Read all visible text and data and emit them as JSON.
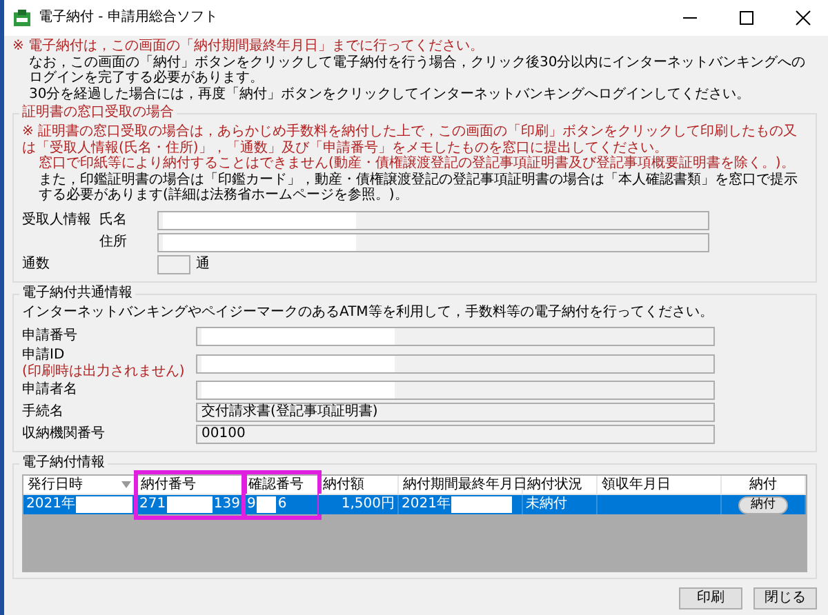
{
  "window": {
    "title": "電子納付 - 申請用総合ソフト"
  },
  "notices": [
    {
      "kind": "warning",
      "text": "※ 電子納付は，この画面の「納付期間最終年月日」までに行ってください。"
    },
    {
      "kind": "info",
      "text": "なお，この画面の「納付」ボタンをクリックして電子納付を行う場合，クリック後30分以内にインターネットバンキングへのログインを完了する必要があります。"
    },
    {
      "kind": "info",
      "text": "30分を経過した場合には，再度「納付」ボタンをクリックしてインターネットバンキングへログインしてください。"
    }
  ],
  "counter_section": {
    "title": "証明書の窓口受取の場合",
    "notes": [
      {
        "kind": "warning",
        "text": "※ 証明書の窓口受取の場合は，あらかじめ手数料を納付した上で，この画面の「印刷」ボタンをクリックして印刷したもの又は「受取人情報(氏名・住所)」，「通数」及び「申請番号」をメモしたものを窓口に提出してください。"
      },
      {
        "kind": "warning",
        "text": "窓口で印紙等により納付することはできません(動産・債権譲渡登記の登記事項証明書及び登記事項概要証明書を除く。)。"
      },
      {
        "kind": "info",
        "text": "また，印鑑証明書の場合は「印鑑カード」，動産・債権譲渡登記の登記事項証明書の場合は「本人確認書類」を窓口で提示する必要があります(詳細は法務省ホームページを参照。)。"
      }
    ],
    "recipient_label": "受取人情報",
    "name_label": "氏名",
    "address_label": "住所",
    "copies_label": "通数",
    "copies_unit": "通"
  },
  "common_section": {
    "title": "電子納付共通情報",
    "description": "インターネットバンキングやペイジーマークのあるATM等を利用して，手数料等の電子納付を行ってください。",
    "fields": [
      {
        "label": "申請番号",
        "redacted": true
      },
      {
        "label": "申請ID",
        "note": "(印刷時は出力されません)",
        "redacted": true
      },
      {
        "label": "申請者名",
        "redacted": true
      },
      {
        "label": "手続名",
        "value": "交付請求書(登記事項証明書)",
        "redacted": false
      },
      {
        "label": "収納機関番号",
        "value": "00100",
        "redacted": false
      }
    ]
  },
  "payment_section": {
    "title": "電子納付情報",
    "columns": [
      {
        "label": "発行日時",
        "highlighted": false,
        "sorted": true
      },
      {
        "label": "納付番号",
        "highlighted": true
      },
      {
        "label": "確認番号",
        "highlighted": true
      },
      {
        "label": "納付額",
        "highlighted": false
      },
      {
        "label": "納付期間最終年月日",
        "highlighted": false
      },
      {
        "label": "納付状況",
        "highlighted": false
      },
      {
        "label": "領収年月日",
        "highlighted": false
      },
      {
        "label": "納付",
        "highlighted": false
      }
    ],
    "rows": [
      {
        "selected": true,
        "cells": [
          {
            "kind": "text",
            "parts": [
              "2021年"
            ],
            "redacted": true
          },
          {
            "kind": "text",
            "parts": [
              "271",
              "139"
            ],
            "redacted": true
          },
          {
            "kind": "text",
            "parts": [
              "9",
              "6"
            ],
            "redacted": true
          },
          {
            "kind": "amount",
            "parts": [
              "1,500円"
            ],
            "redacted": false
          },
          {
            "kind": "text",
            "parts": [
              "2021年"
            ],
            "redacted": true
          },
          {
            "kind": "text",
            "parts": [
              "未納付"
            ],
            "redacted": false
          },
          {
            "kind": "text",
            "redacted": false
          },
          {
            "kind": "button",
            "parts": [
              "納付"
            ],
            "redacted": false
          }
        ]
      }
    ]
  },
  "buttons": [
    "印刷",
    "閉じる"
  ]
}
